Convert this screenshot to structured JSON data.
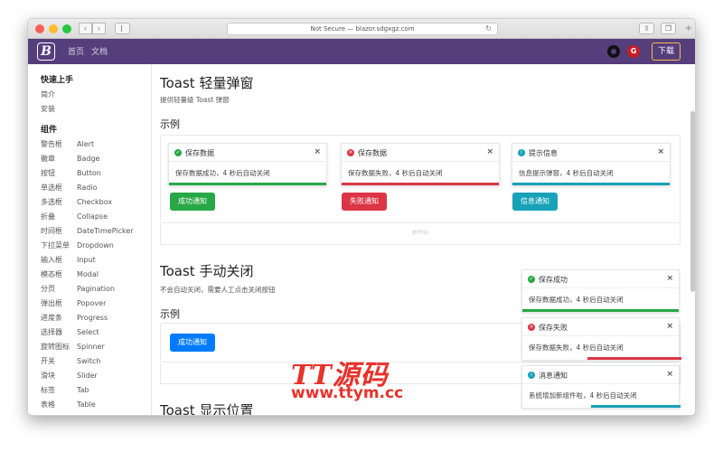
{
  "browser": {
    "url": "Not Secure — blazor.sdgxgz.com",
    "traffic_colors": [
      "#ff5f57",
      "#febc2e",
      "#28c840"
    ],
    "back_icon": "chevron-left-icon",
    "forward_icon": "chevron-right-icon"
  },
  "navbar": {
    "logo": "B",
    "links": [
      "首页",
      "文档"
    ],
    "download": "下载",
    "brand_color": "#563d7c"
  },
  "sidebar": {
    "sections": [
      {
        "title": "快速上手",
        "items": [
          {
            "cn": "简介",
            "en": ""
          },
          {
            "cn": "安装",
            "en": ""
          }
        ]
      },
      {
        "title": "组件",
        "items": [
          {
            "cn": "警告框",
            "en": "Alert"
          },
          {
            "cn": "徽章",
            "en": "Badge"
          },
          {
            "cn": "按钮",
            "en": "Button"
          },
          {
            "cn": "单选框",
            "en": "Radio"
          },
          {
            "cn": "多选框",
            "en": "Checkbox"
          },
          {
            "cn": "折叠",
            "en": "Collapse"
          },
          {
            "cn": "时间框",
            "en": "DateTimePicker"
          },
          {
            "cn": "下拉菜单",
            "en": "Dropdown"
          },
          {
            "cn": "输入框",
            "en": "Input"
          },
          {
            "cn": "模态框",
            "en": "Modal"
          },
          {
            "cn": "分页",
            "en": "Pagination"
          },
          {
            "cn": "弹出框",
            "en": "Popover"
          },
          {
            "cn": "进度条",
            "en": "Progress"
          },
          {
            "cn": "选择器",
            "en": "Select"
          },
          {
            "cn": "旋转图标",
            "en": "Spinner"
          },
          {
            "cn": "开关",
            "en": "Switch"
          },
          {
            "cn": "滑块",
            "en": "Slider"
          },
          {
            "cn": "标签",
            "en": "Tab"
          },
          {
            "cn": "表格",
            "en": "Table"
          }
        ]
      }
    ]
  },
  "main": {
    "section1": {
      "title": "Toast 轻量弹窗",
      "desc": "提供轻量级 Toast 弹窗",
      "example": "示例",
      "toasts": [
        {
          "title": "保存数据",
          "body": "保存数据成功，4 秒后自动关闭",
          "color": "#28a745",
          "icon": "check-circle-icon"
        },
        {
          "title": "保存数据",
          "body": "保存数据失败，4 秒后自动关闭",
          "color": "#dc3545",
          "icon": "x-circle-icon"
        },
        {
          "title": "提示信息",
          "body": "信息提示弹窗，4 秒后自动关闭",
          "color": "#17a2b8",
          "icon": "info-circle-icon"
        }
      ],
      "buttons": [
        {
          "label": "成功通知",
          "color": "#28a745"
        },
        {
          "label": "失败通知",
          "color": "#dc3545"
        },
        {
          "label": "信息通知",
          "color": "#17a2b8"
        }
      ],
      "ghost_text": "emo"
    },
    "section2": {
      "title": "Toast 手动关闭",
      "desc": "不会自动关闭，需要人工点击关闭按钮",
      "example": "示例",
      "button": {
        "label": "成功通知",
        "color": "#007bff"
      }
    },
    "section3": {
      "title": "Toast 显示位置"
    }
  },
  "floating_toasts": [
    {
      "title": "保存成功",
      "body": "保存数据成功，4 秒后自动关闭",
      "color": "#28a745",
      "icon": "check-circle-icon",
      "progress": 1.0
    },
    {
      "title": "保存失败",
      "body": "保存数据失败，4 秒后自动关闭",
      "color": "#dc3545",
      "icon": "x-circle-icon",
      "progress": 0.6
    },
    {
      "title": "消息通知",
      "body": "系统增加新组件啦，4 秒后自动关闭",
      "color": "#17a2b8",
      "icon": "info-circle-icon",
      "progress": 0.6
    }
  ],
  "watermark": {
    "line1": "TT源码",
    "line2": "www.ttym.cc"
  }
}
